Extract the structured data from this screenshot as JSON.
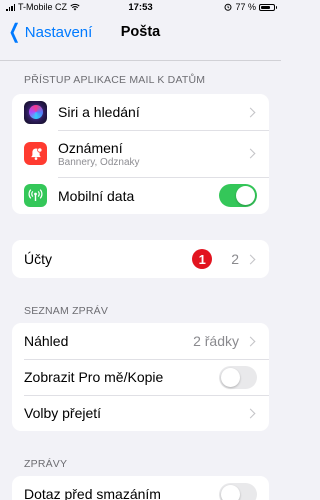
{
  "status_bar": {
    "carrier": "T-Mobile CZ",
    "time": "17:53",
    "battery_text": "77 %",
    "battery_level": 0.77
  },
  "nav": {
    "back_label": "Nastavení",
    "title": "Pošta"
  },
  "sections": {
    "access_header": "PŘÍSTUP APLIKACE MAIL K DATŮM",
    "messages_list_header": "SEZNAM ZPRÁV",
    "messages_header": "ZPRÁVY"
  },
  "access": {
    "siri": {
      "label": "Siri a hledání",
      "icon": "siri-icon"
    },
    "notifications": {
      "label": "Oznámení",
      "sublabel": "Bannery, Odznaky",
      "icon": "bell-icon"
    },
    "cellular": {
      "label": "Mobilní data",
      "icon": "antenna-icon",
      "enabled": true
    }
  },
  "accounts": {
    "label": "Účty",
    "badge": "1",
    "value": "2"
  },
  "message_list": {
    "preview": {
      "label": "Náhled",
      "value": "2 řádky"
    },
    "show_to_cc": {
      "label": "Zobrazit Pro mě/Kopie",
      "enabled": false
    },
    "swipe_options": {
      "label": "Volby přejetí"
    }
  },
  "messages": {
    "ask_before_delete": {
      "label": "Dotaz před smazáním",
      "enabled": false
    }
  },
  "colors": {
    "accent": "#007aff",
    "toggle_on": "#34c759",
    "badge": "#e2141f",
    "notifications_icon": "#ff3b30"
  }
}
